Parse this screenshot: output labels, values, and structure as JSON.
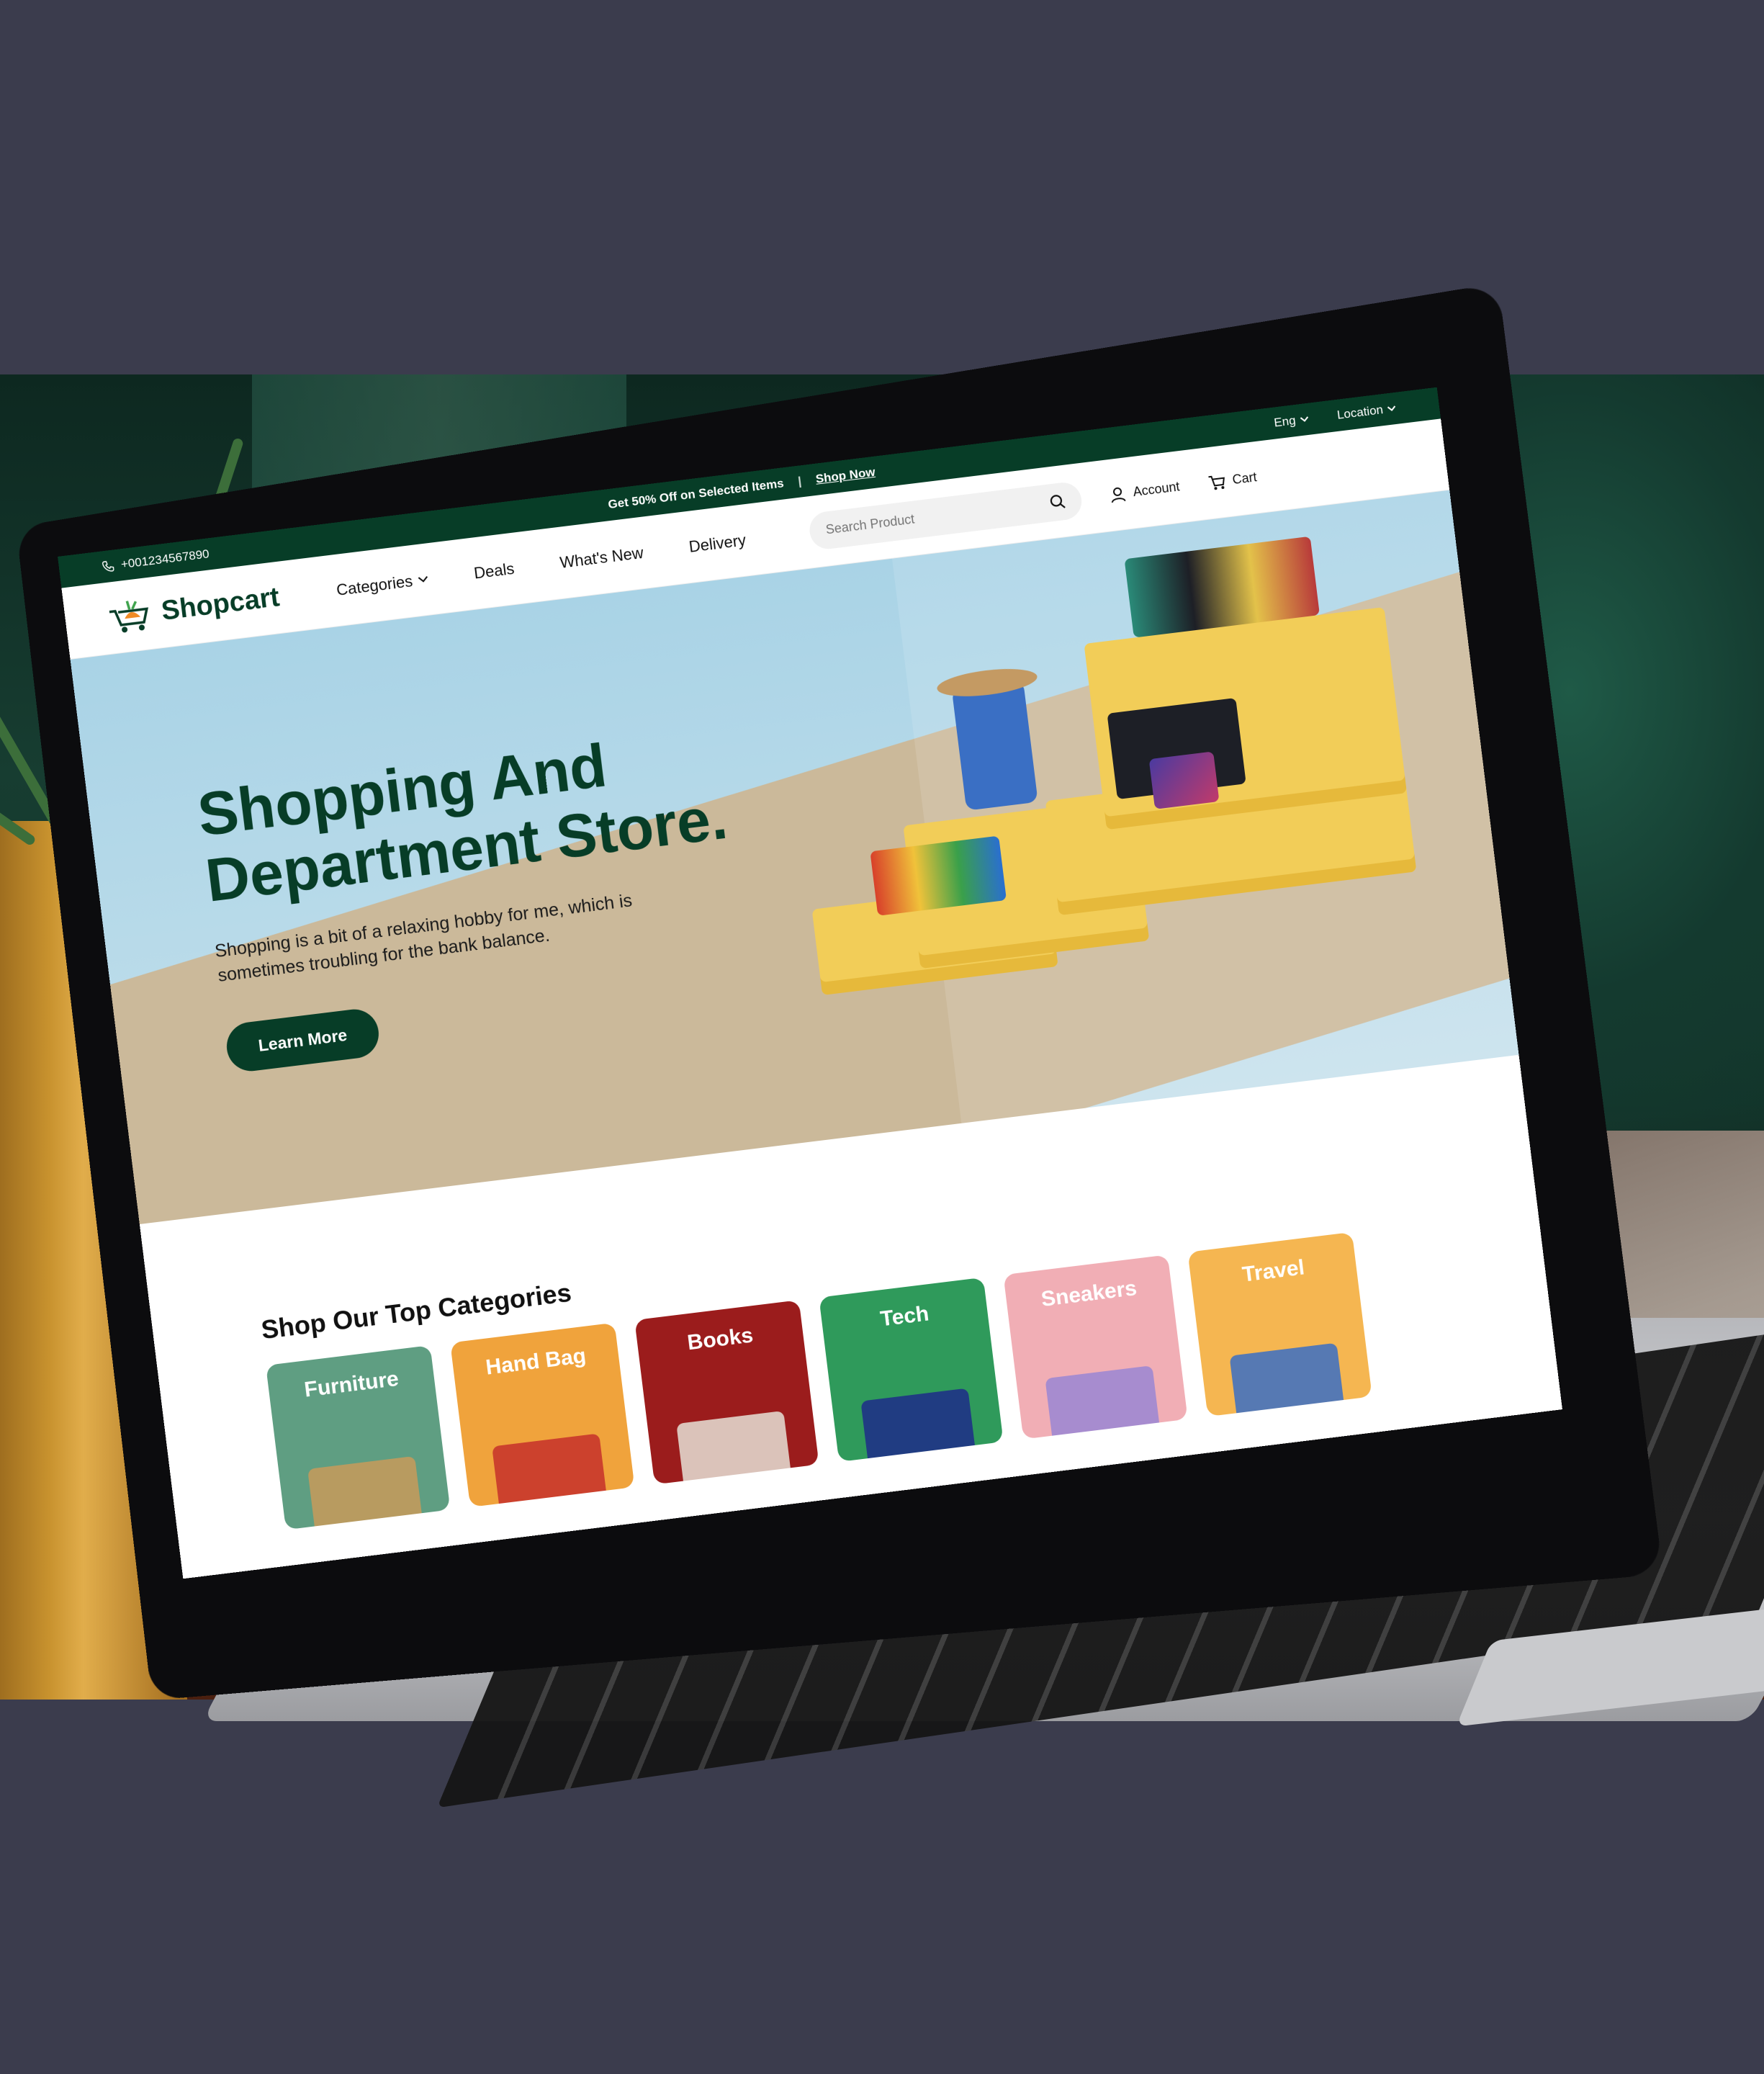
{
  "topbar": {
    "phone": "+001234567890",
    "promo_text": "Get 50% Off on Selected Items",
    "promo_sep": "|",
    "promo_link": "Shop Now",
    "language": "Eng",
    "location": "Location"
  },
  "nav": {
    "brand": "Shopcart",
    "links": [
      "Categories",
      "Deals",
      "What's New",
      "Delivery"
    ],
    "search_placeholder": "Search Product",
    "account": "Account",
    "cart": "Cart"
  },
  "hero": {
    "title_line1": "Shopping And",
    "title_line2": "Department Store.",
    "subtitle": "Shopping is a bit of a relaxing hobby for me, which is sometimes troubling for the bank balance.",
    "cta": "Learn More"
  },
  "categories": {
    "title": "Shop Our Top Categories",
    "items": [
      {
        "label": "Furniture",
        "color": "#5f9e82"
      },
      {
        "label": "Hand Bag",
        "color": "#f0a33c"
      },
      {
        "label": "Books",
        "color": "#9b1c1c"
      },
      {
        "label": "Tech",
        "color": "#2f9a5b"
      },
      {
        "label": "Sneakers",
        "color": "#f1aeb5"
      },
      {
        "label": "Travel",
        "color": "#f5b651"
      }
    ]
  },
  "colors": {
    "brand_green": "#073d27",
    "hero_sky": "#a9d3e6",
    "platform_yellow": "#f2cd58"
  },
  "icons": [
    "phone-icon",
    "chevron-down-icon",
    "search-icon",
    "user-icon",
    "cart-icon"
  ]
}
